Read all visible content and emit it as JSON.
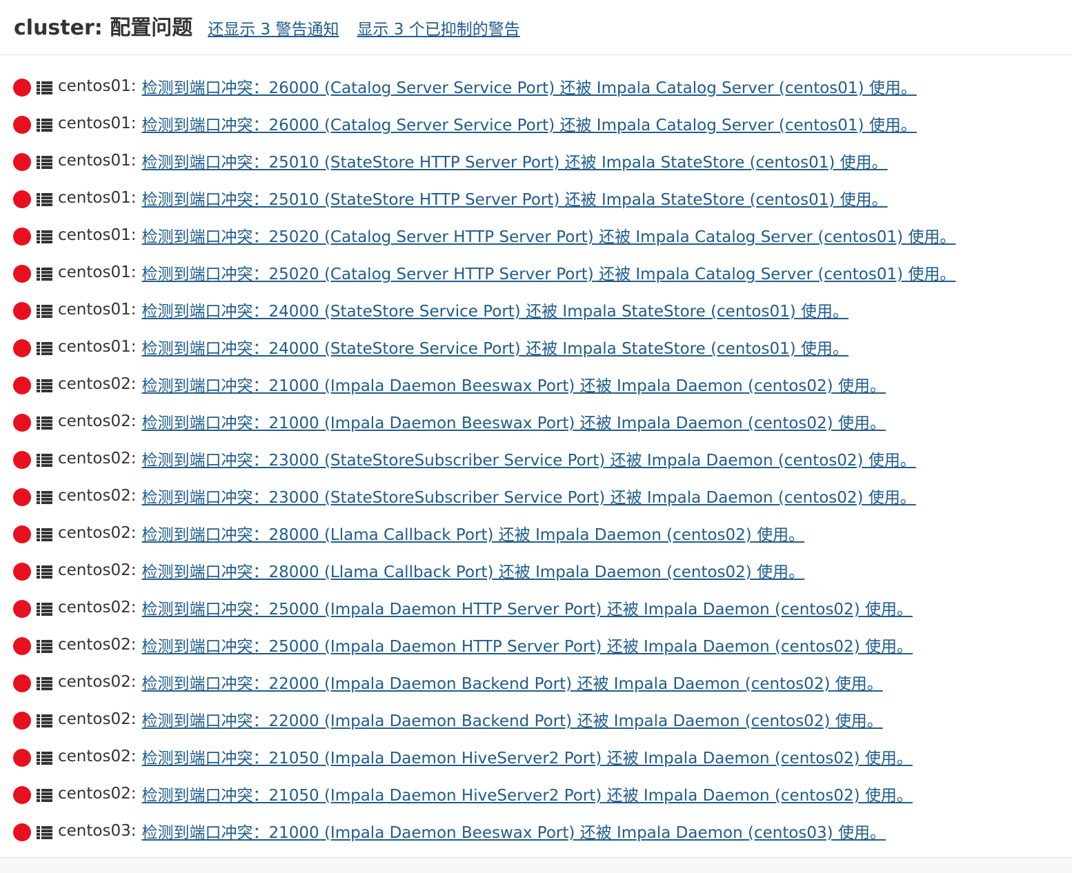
{
  "header": {
    "title": "cluster: 配置问题",
    "show_alerts_link": "还显示 3 警告通知",
    "show_suppressed_link": "显示 3 个已抑制的警告"
  },
  "colors": {
    "error": "#e8101f",
    "link": "#1f5c8c",
    "text": "#333333"
  },
  "icons": {
    "status": "error-status-icon",
    "role": "list-icon"
  },
  "issues": [
    {
      "host": "centos01:",
      "message": "检测到端口冲突：26000 (Catalog Server Service Port) 还被 Impala Catalog Server (centos01) 使用。"
    },
    {
      "host": "centos01:",
      "message": "检测到端口冲突：26000 (Catalog Server Service Port) 还被 Impala Catalog Server (centos01) 使用。"
    },
    {
      "host": "centos01:",
      "message": "检测到端口冲突：25010 (StateStore HTTP Server Port) 还被 Impala StateStore (centos01) 使用。"
    },
    {
      "host": "centos01:",
      "message": "检测到端口冲突：25010 (StateStore HTTP Server Port) 还被 Impala StateStore (centos01) 使用。"
    },
    {
      "host": "centos01:",
      "message": "检测到端口冲突：25020 (Catalog Server HTTP Server Port) 还被 Impala Catalog Server (centos01) 使用。"
    },
    {
      "host": "centos01:",
      "message": "检测到端口冲突：25020 (Catalog Server HTTP Server Port) 还被 Impala Catalog Server (centos01) 使用。"
    },
    {
      "host": "centos01:",
      "message": "检测到端口冲突：24000 (StateStore Service Port) 还被 Impala StateStore (centos01) 使用。"
    },
    {
      "host": "centos01:",
      "message": "检测到端口冲突：24000 (StateStore Service Port) 还被 Impala StateStore (centos01) 使用。"
    },
    {
      "host": "centos02:",
      "message": "检测到端口冲突：21000 (Impala Daemon Beeswax Port) 还被 Impala Daemon (centos02) 使用。"
    },
    {
      "host": "centos02:",
      "message": "检测到端口冲突：21000 (Impala Daemon Beeswax Port) 还被 Impala Daemon (centos02) 使用。"
    },
    {
      "host": "centos02:",
      "message": "检测到端口冲突：23000 (StateStoreSubscriber Service Port) 还被 Impala Daemon (centos02) 使用。"
    },
    {
      "host": "centos02:",
      "message": "检测到端口冲突：23000 (StateStoreSubscriber Service Port) 还被 Impala Daemon (centos02) 使用。"
    },
    {
      "host": "centos02:",
      "message": "检测到端口冲突：28000 (Llama Callback Port) 还被 Impala Daemon (centos02) 使用。"
    },
    {
      "host": "centos02:",
      "message": "检测到端口冲突：28000 (Llama Callback Port) 还被 Impala Daemon (centos02) 使用。"
    },
    {
      "host": "centos02:",
      "message": "检测到端口冲突：25000 (Impala Daemon HTTP Server Port) 还被 Impala Daemon (centos02) 使用。"
    },
    {
      "host": "centos02:",
      "message": "检测到端口冲突：25000 (Impala Daemon HTTP Server Port) 还被 Impala Daemon (centos02) 使用。"
    },
    {
      "host": "centos02:",
      "message": "检测到端口冲突：22000 (Impala Daemon Backend Port) 还被 Impala Daemon (centos02) 使用。"
    },
    {
      "host": "centos02:",
      "message": "检测到端口冲突：22000 (Impala Daemon Backend Port) 还被 Impala Daemon (centos02) 使用。"
    },
    {
      "host": "centos02:",
      "message": "检测到端口冲突：21050 (Impala Daemon HiveServer2 Port) 还被 Impala Daemon (centos02) 使用。"
    },
    {
      "host": "centos02:",
      "message": "检测到端口冲突：21050 (Impala Daemon HiveServer2 Port) 还被 Impala Daemon (centos02) 使用。"
    },
    {
      "host": "centos03:",
      "message": "检测到端口冲突：21000 (Impala Daemon Beeswax Port) 还被 Impala Daemon (centos03) 使用。"
    }
  ]
}
